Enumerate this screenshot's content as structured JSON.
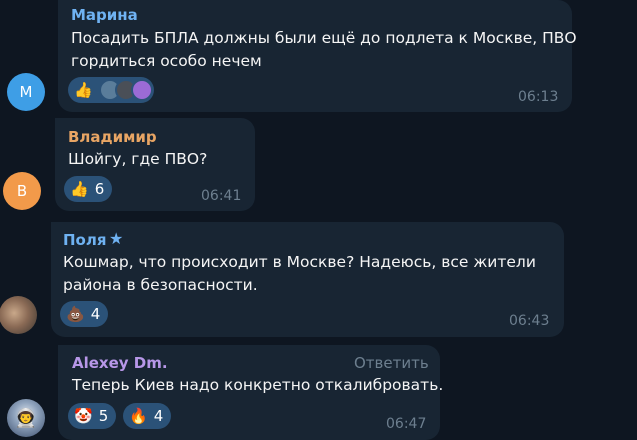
{
  "messages": [
    {
      "author": "Марина",
      "author_color": "#6fb2f2",
      "avatar_letter": "М",
      "avatar_color": "#3e9ee6",
      "lines": [
        "Посадить БПЛА должны были ещё до подлета к Москве, ПВО",
        "гордиться особо нечем"
      ],
      "reaction": {
        "emoji": "👍"
      },
      "time": "06:13"
    },
    {
      "author": "Владимир",
      "author_color": "#e8a564",
      "avatar_letter": "В",
      "avatar_color": "#f29a4a",
      "lines": [
        "Шойгу, где ПВО?"
      ],
      "reaction": {
        "emoji": "👍",
        "count": "6"
      },
      "time": "06:41"
    },
    {
      "author": "Поля",
      "author_color": "#6fb2f2",
      "lines": [
        "Кошмар, что происходит в Москве? Надеюсь, все жители",
        "района в безопасности."
      ],
      "reaction": {
        "emoji": "💩",
        "count": "4"
      },
      "time": "06:43"
    },
    {
      "author": "Alexey Dm.",
      "author_color": "#b797e8",
      "reply_label": "Ответить",
      "lines": [
        "Теперь Киев надо конкретно откалибровать."
      ],
      "reactions": [
        {
          "emoji": "🤡",
          "count": "5"
        },
        {
          "emoji": "🔥",
          "count": "4"
        }
      ],
      "time": "06:47"
    }
  ]
}
